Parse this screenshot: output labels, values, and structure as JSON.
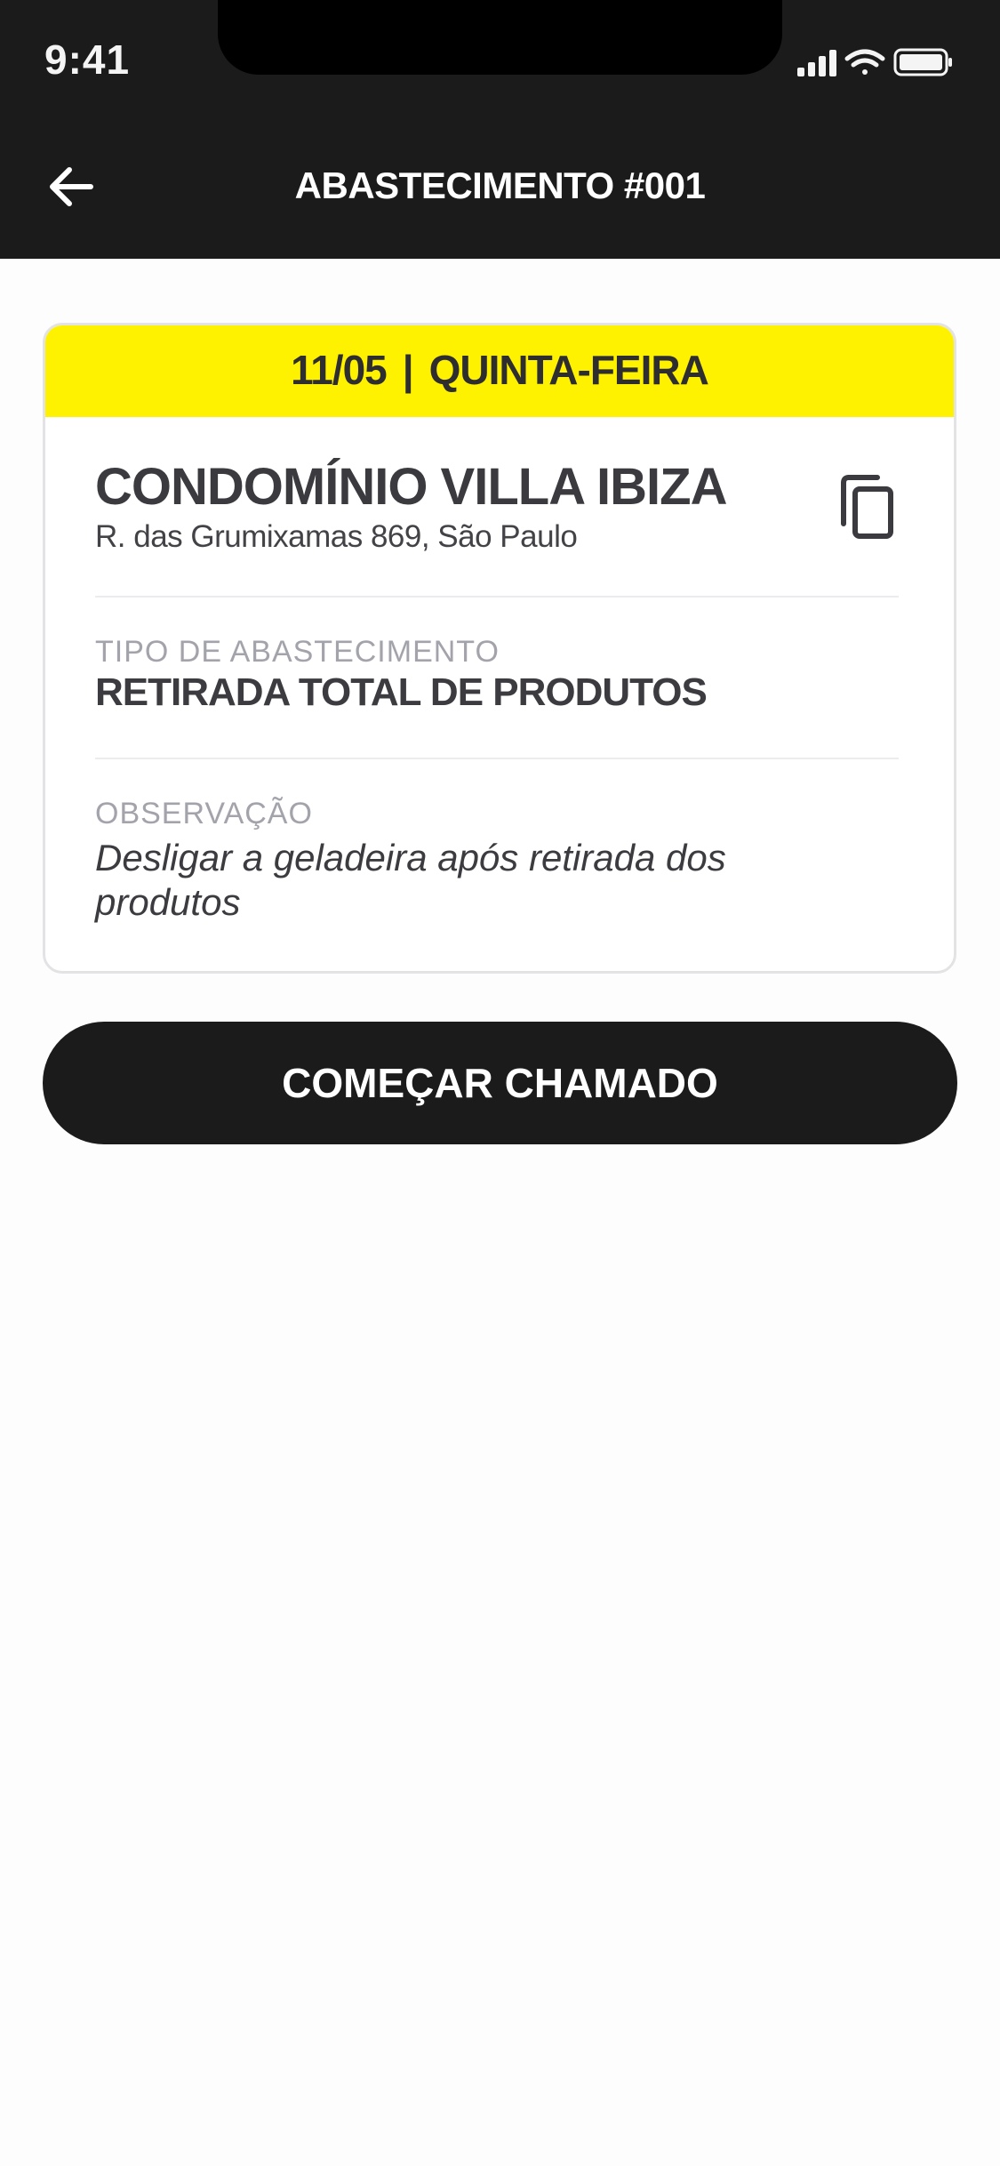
{
  "status_bar": {
    "time": "9:41"
  },
  "header": {
    "title": "ABASTECIMENTO #001",
    "back_icon": "arrow-left-icon"
  },
  "card": {
    "date": "11/05",
    "separator": "|",
    "weekday": "QUINTA-FEIRA",
    "place_name": "CONDOMÍNIO VILLA IBIZA",
    "address": "R. das Grumixamas 869, São Paulo",
    "copy_icon": "copy-icon",
    "supply_type_label": "TIPO DE ABASTECIMENTO",
    "supply_type_value": "RETIRADA TOTAL DE PRODUTOS",
    "note_label": "OBSERVAÇÃO",
    "note_value": "Desligar a geladeira após retirada dos produtos"
  },
  "actions": {
    "start_label": "COMEÇAR CHAMADO"
  },
  "colors": {
    "header_bg": "#1b1b1c",
    "accent_yellow": "#fff200",
    "button_bg": "#1b1b1c",
    "label_gray": "#a3a3ab"
  }
}
